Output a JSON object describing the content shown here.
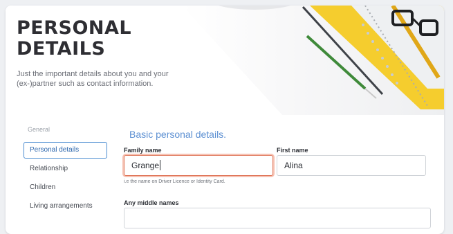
{
  "header": {
    "title": "PERSONAL DETAILS",
    "subtitle": "Just the important details about you and your (ex-)partner such as contact information."
  },
  "sidebar": {
    "heading": "General",
    "items": [
      {
        "label": "Personal details",
        "active": true
      },
      {
        "label": "Relationship",
        "active": false
      },
      {
        "label": "Children",
        "active": false
      },
      {
        "label": "Living arrangements",
        "active": false
      }
    ]
  },
  "form": {
    "section_title": "Basic personal details.",
    "family_name": {
      "label": "Family name",
      "value": "Grange",
      "hint": "i.e the name on Driver Licence or Identity Card."
    },
    "first_name": {
      "label": "First name",
      "value": "Alina"
    },
    "middle_names": {
      "label": "Any middle names",
      "value": ""
    }
  },
  "colors": {
    "accent": "#5b8fd2",
    "focus_ring": "#e0785c",
    "notebook_yellow": "#f6d13a"
  }
}
